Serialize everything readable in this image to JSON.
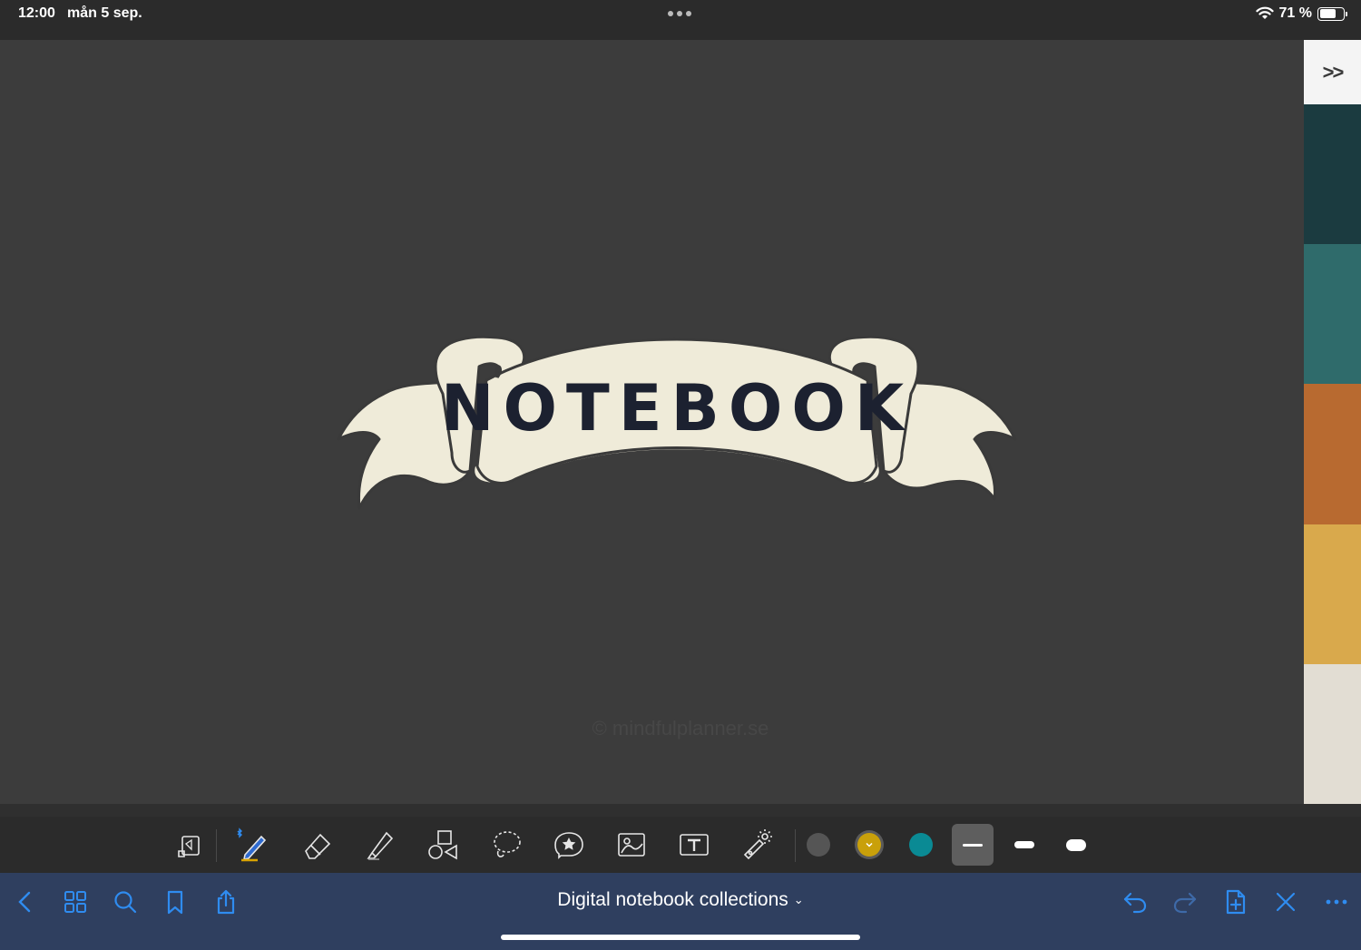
{
  "status_bar": {
    "time": "12:00",
    "date": "mån 5 sep.",
    "battery": "71 %",
    "battery_level": 0.71
  },
  "canvas": {
    "banner_text": "NOTEBOOK",
    "watermark": "© mindfulplanner.se",
    "background": "#3c3c3c",
    "banner_color": "#efebd9",
    "ink_color": "#1c2130"
  },
  "side_tabs": {
    "toggle_label": ">>",
    "colors": [
      "#1b3b40",
      "#2f6b6b",
      "#b86a30",
      "#d9a94c",
      "#e2ddd3"
    ]
  },
  "toolbar": {
    "tools": [
      {
        "name": "page-view-icon"
      },
      {
        "name": "pen-icon",
        "active": true,
        "bluetooth": true
      },
      {
        "name": "eraser-icon"
      },
      {
        "name": "highlighter-icon"
      },
      {
        "name": "shapes-icon"
      },
      {
        "name": "lasso-icon"
      },
      {
        "name": "sticker-icon"
      },
      {
        "name": "image-icon"
      },
      {
        "name": "text-icon"
      },
      {
        "name": "laser-pointer-icon"
      }
    ],
    "colors": [
      "#555555",
      "#c9a00a",
      "#0a8a94"
    ],
    "selected_color_index": 1,
    "stroke_sizes": [
      "thin",
      "medium",
      "thick"
    ],
    "selected_stroke_index": 0
  },
  "navbar": {
    "title": "Digital notebook collections",
    "accent": "#2f8cf0"
  }
}
